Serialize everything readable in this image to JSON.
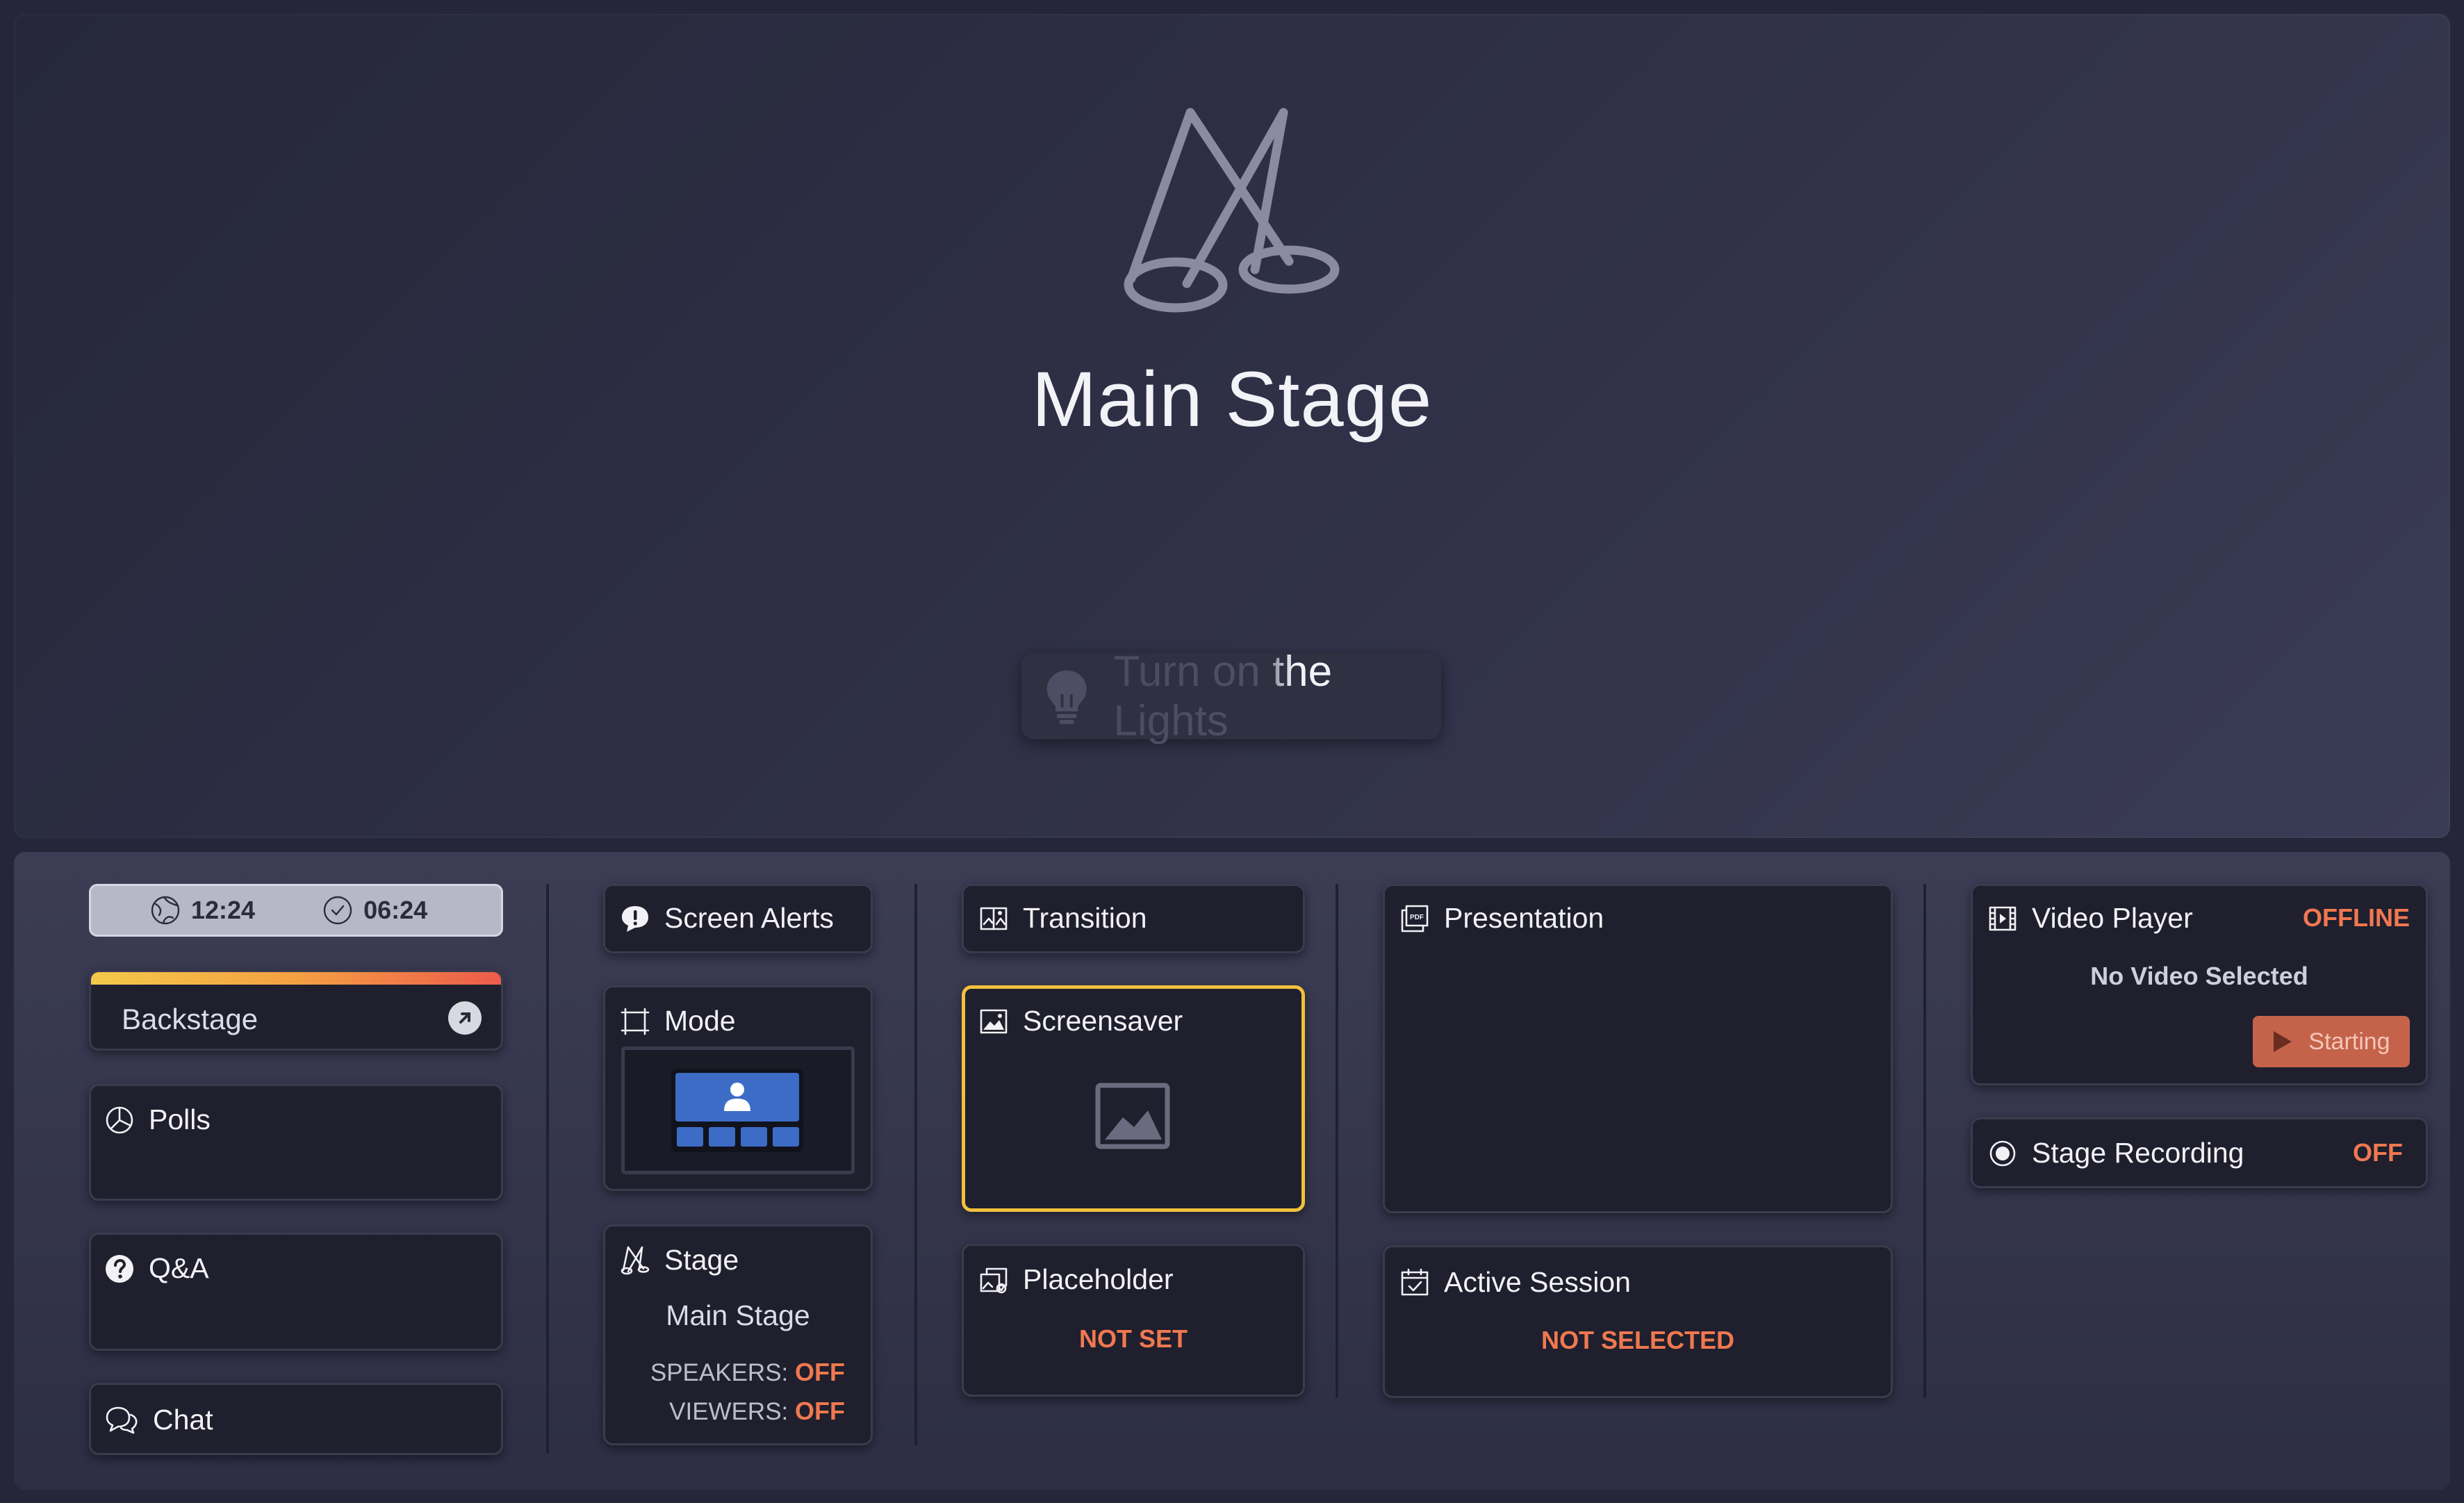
{
  "stage": {
    "title": "Main Stage",
    "lights_button": "Turn on the Lights"
  },
  "clocks": {
    "local_time": "12:24",
    "elapsed_time": "06:24"
  },
  "backstage": {
    "label": "Backstage"
  },
  "polls": {
    "label": "Polls"
  },
  "qa": {
    "label": "Q&A"
  },
  "chat": {
    "label": "Chat"
  },
  "screen_alerts": {
    "label": "Screen Alerts"
  },
  "mode": {
    "label": "Mode"
  },
  "stage_card": {
    "label": "Stage",
    "stage_name": "Main Stage",
    "speakers_label": "SPEAKERS:",
    "speakers_value": "OFF",
    "viewers_label": "VIEWERS:",
    "viewers_value": "OFF"
  },
  "transition": {
    "label": "Transition"
  },
  "screensaver": {
    "label": "Screensaver"
  },
  "placeholder": {
    "label": "Placeholder",
    "status": "NOT SET"
  },
  "presentation": {
    "label": "Presentation"
  },
  "active_session": {
    "label": "Active Session",
    "status": "NOT SELECTED"
  },
  "video_player": {
    "label": "Video Player",
    "status": "OFFLINE",
    "message": "No Video Selected",
    "button": "Starting"
  },
  "stage_recording": {
    "label": "Stage Recording",
    "status": "OFF"
  },
  "colors": {
    "accent_orange": "#f07850",
    "highlight_yellow": "#f1c03c",
    "mode_blue": "#3d6cc7"
  }
}
